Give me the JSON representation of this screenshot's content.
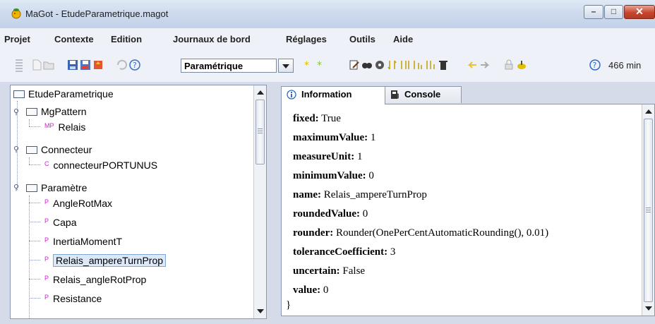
{
  "window": {
    "title": "MaGot - EtudeParametrique.magot",
    "close_glyph": "✕",
    "min_glyph": "–",
    "max_glyph": "□"
  },
  "menubar": {
    "items": [
      "Projet",
      "Contexte",
      "Edition",
      "Journaux de bord",
      "Réglages",
      "Outils",
      "Aide"
    ]
  },
  "toolbar": {
    "mode_value": "Paramétrique",
    "status_text": "466 min"
  },
  "tree": {
    "root": "EtudeParametrique",
    "groups": [
      {
        "label": "MgPattern",
        "children": [
          {
            "badge": "MP",
            "label": "Relais"
          }
        ]
      },
      {
        "label": "Connecteur",
        "children": [
          {
            "badge": "C",
            "label": "connecteurPORTUNUS"
          }
        ]
      },
      {
        "label": "Paramètre",
        "children": [
          {
            "badge": "P",
            "label": "AngleRotMax"
          },
          {
            "badge": "P",
            "label": "Capa"
          },
          {
            "badge": "P",
            "label": "InertiaMomentT"
          },
          {
            "badge": "P",
            "label": "Relais_ampereTurnProp"
          },
          {
            "badge": "P",
            "label": "Relais_angleRotProp"
          },
          {
            "badge": "P",
            "label": "Resistance"
          }
        ]
      }
    ]
  },
  "tabs": {
    "information": "Information",
    "console": "Console"
  },
  "properties": [
    {
      "key": "fixed:",
      "value": "True"
    },
    {
      "key": "maximumValue:",
      "value": "1"
    },
    {
      "key": "measureUnit:",
      "value": "1"
    },
    {
      "key": "minimumValue:",
      "value": "0"
    },
    {
      "key": "name:",
      "value": "Relais_ampereTurnProp"
    },
    {
      "key": "roundedValue:",
      "value": "0"
    },
    {
      "key": "rounder:",
      "value": "Rounder(OnePerCentAutomaticRounding(), 0.01)"
    },
    {
      "key": "toleranceCoefficient:",
      "value": "3"
    },
    {
      "key": "uncertain:",
      "value": "False"
    },
    {
      "key": "value:",
      "value": "0"
    }
  ],
  "closing_brace": "}",
  "colors": {
    "badge": "#d01fd0",
    "selection": "#dce8f8",
    "close_button": "#c7452e"
  }
}
